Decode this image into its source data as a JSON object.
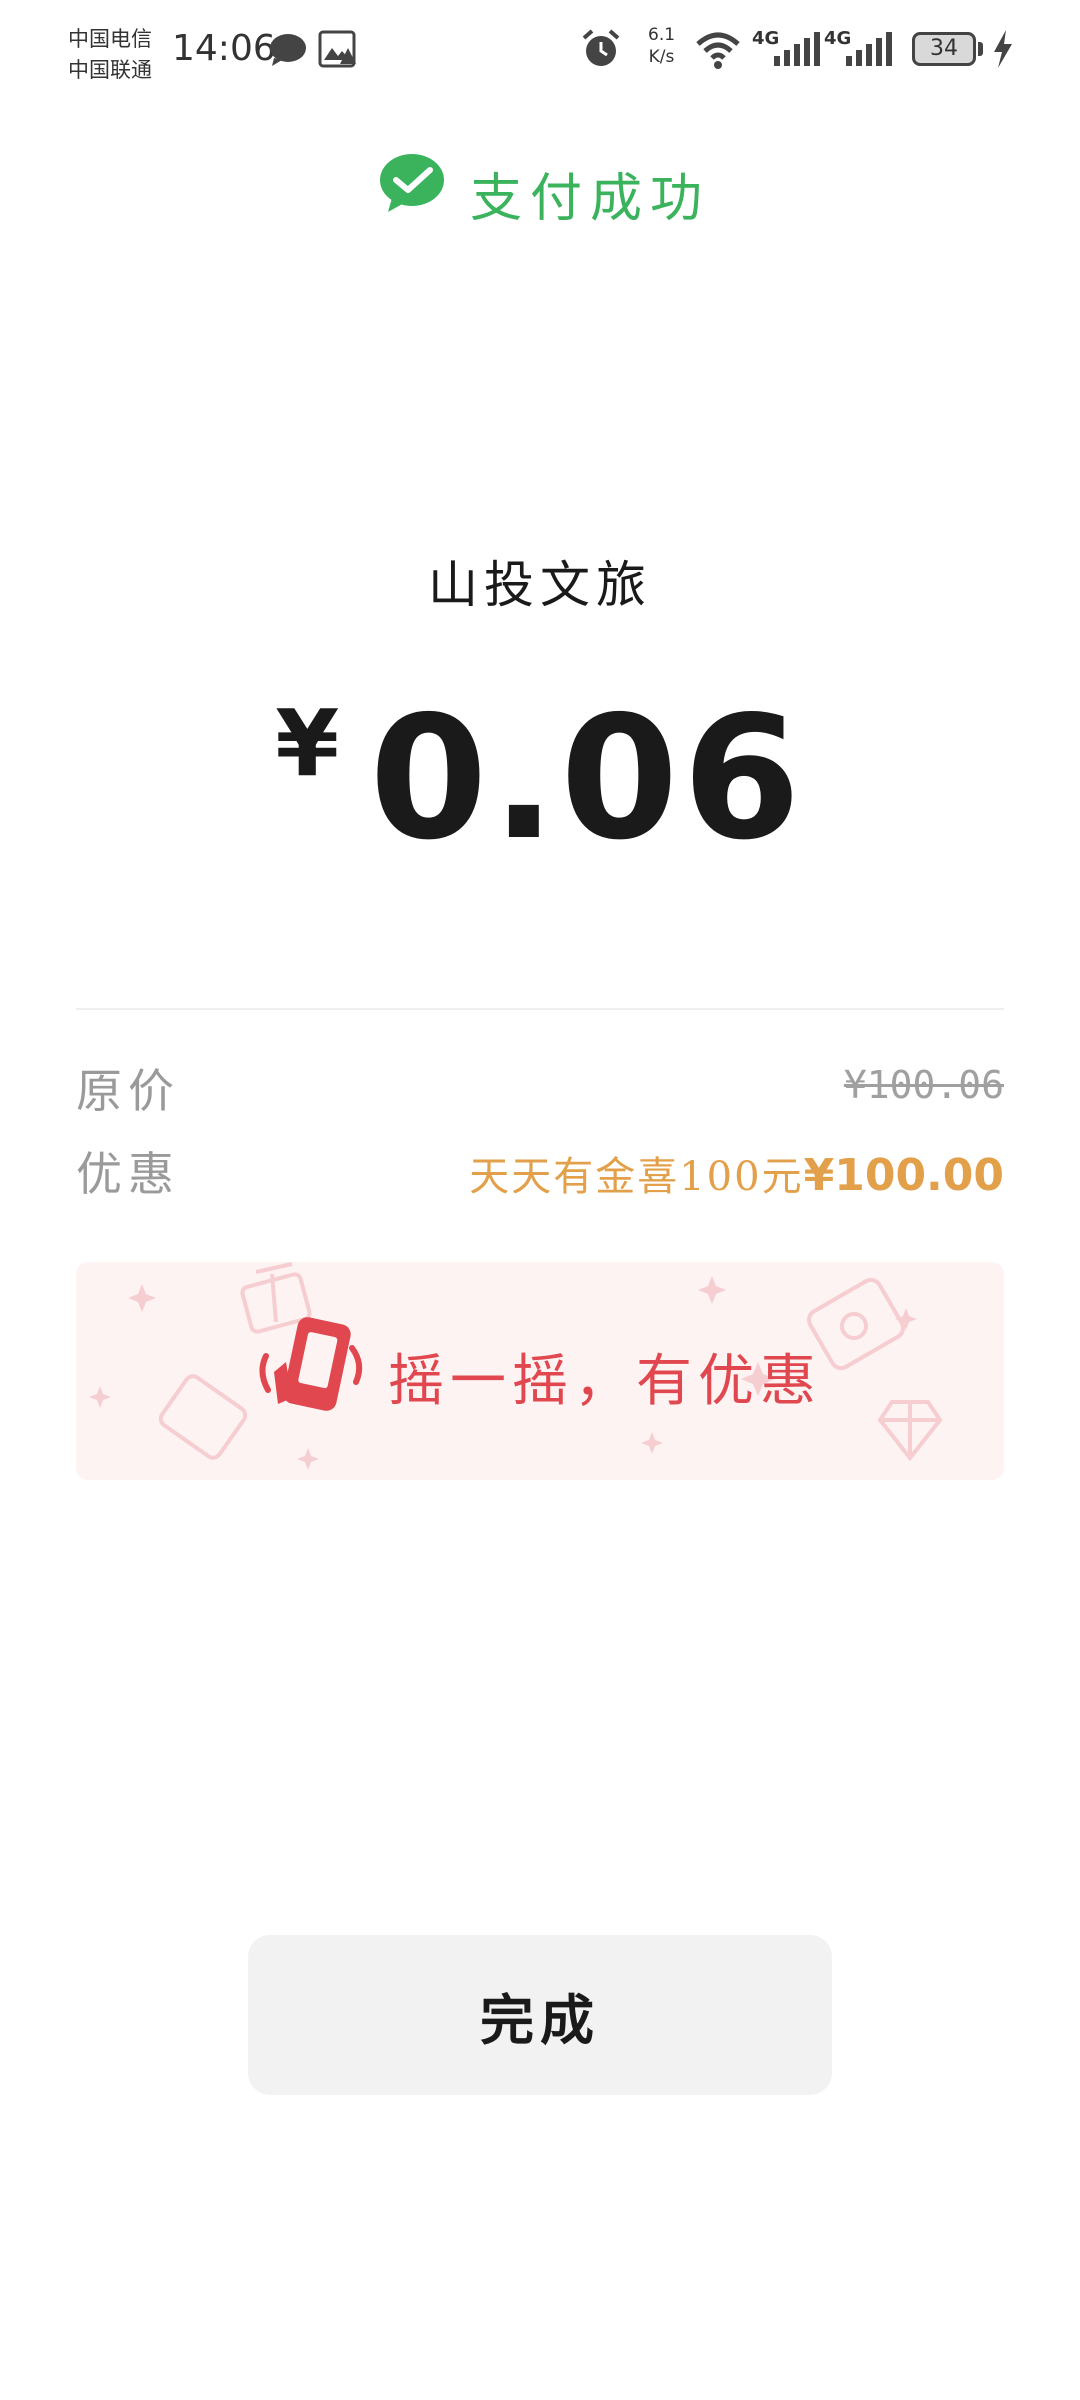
{
  "status_bar": {
    "carrier1": "中国电信",
    "carrier2": "中国联通",
    "time": "14:06",
    "speed_value": "6.1",
    "speed_unit": "K/s",
    "net1": "4G",
    "net2": "4G",
    "battery": "34"
  },
  "header": {
    "title": "支付成功",
    "icon": "wechat-pay-icon"
  },
  "payment": {
    "merchant": "山投文旅",
    "currency": "¥",
    "amount": "0.06"
  },
  "details": {
    "original_label": "原价",
    "original_value": "¥100.06",
    "discount_label": "优惠",
    "discount_name": "天天有金喜100元",
    "discount_amount": "¥100.00"
  },
  "banner": {
    "text": "摇一摇，有优惠",
    "icon": "shake-phone-icon"
  },
  "actions": {
    "done": "完成"
  },
  "colors": {
    "brand_green": "#3bb35c",
    "discount_orange": "#e3a04a",
    "banner_red": "#e0474f",
    "banner_bg": "#fdf3f3",
    "button_bg": "#f2f2f2"
  }
}
